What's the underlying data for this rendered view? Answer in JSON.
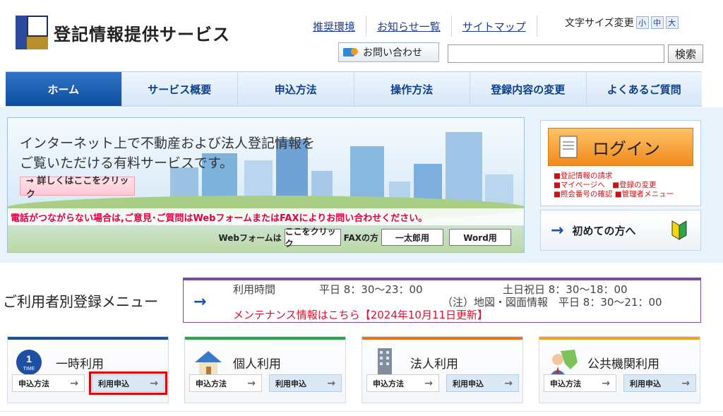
{
  "header": {
    "site_title": "登記情報提供サービス",
    "links": [
      "推奨環境",
      "お知らせ一覧",
      "サイトマップ"
    ],
    "font_size_label": "文字サイズ変更",
    "font_sizes": [
      "小",
      "中",
      "大"
    ],
    "contact_label": "お問い合わせ",
    "search_value": "",
    "search_button": "検索"
  },
  "nav": {
    "items": [
      "ホーム",
      "サービス概要",
      "申込方法",
      "操作方法",
      "登録内容の変更",
      "よくあるご質問"
    ],
    "active_index": 0
  },
  "hero": {
    "line1": "インターネット上で不動産および法人登記情報を",
    "line2": "ご覧いただける有料サービスです。",
    "detail_link": "→ 詳しくはここをクリック",
    "notice": "電話がつながらない場合は,ご意見･ご質問はWebフォームまたはFAXによりお問い合わせください。",
    "webform_label": "Webフォームは",
    "webform_button": "ここをクリック",
    "fax_label": "FAXの方",
    "fax_button1": "一太郎用",
    "fax_button2": "Word用"
  },
  "login": {
    "button_label": "ログイン",
    "sub1": "■登記情報の請求",
    "sub2": "■マイページへ",
    "sub3": "■登録の変更",
    "sub4": "■照会番号の確認",
    "sub5": "■管理者メニュー"
  },
  "first_time": {
    "label": "初めての方へ"
  },
  "menu": {
    "title": "ご利用者別登録メニュー"
  },
  "hours": {
    "label": "利用時間",
    "weekday": "平日 8：30～23：00",
    "holiday": "土日祝日 8：30～18：00",
    "note": "（注）地図・図面情報　平日 8：30～21：00",
    "maintenance": "メンテナンス情報はこちら【2024年10月11日更新】"
  },
  "cards": [
    {
      "title": "一時利用",
      "apply_method": "申込方法",
      "apply": "利用申込",
      "color": "#1f4fa3",
      "time_top": "1",
      "time_bottom": "TIME"
    },
    {
      "title": "個人利用",
      "apply_method": "申込方法",
      "apply": "利用申込",
      "color": "#2aa64a"
    },
    {
      "title": "法人利用",
      "apply_method": "申込方法",
      "apply": "利用申込",
      "color": "#e8711c"
    },
    {
      "title": "公共機関利用",
      "apply_method": "申込方法",
      "apply": "利用申込",
      "color": "#f0a21c"
    }
  ],
  "colors": {
    "nav_active": "#1f5fb4",
    "notice_red": "#e2004b",
    "login_orange": "#f5a33b",
    "highlight_box": "#e00000"
  },
  "icons": {
    "logo": "logo-mark-icon",
    "contact": "contact-icon",
    "login_doc": "document-icon",
    "first_time": "beginner-leaf-icon"
  }
}
